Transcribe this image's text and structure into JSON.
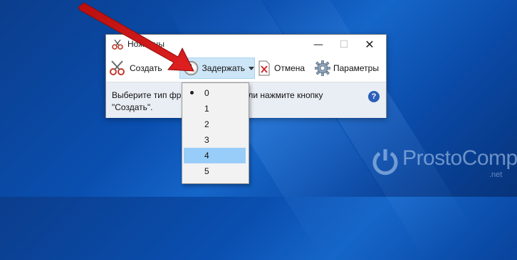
{
  "window": {
    "title": "Ножницы"
  },
  "toolbar": {
    "new_label": "Создать",
    "delay_label": "Задержать",
    "cancel_label": "Отмена",
    "options_label": "Параметры"
  },
  "info": {
    "line1": "Выберите тип фр",
    "line1_rest": "ли нажмите кнопку",
    "line2": "\"Создать\"."
  },
  "delay_menu": {
    "items": [
      "0",
      "1",
      "2",
      "3",
      "4",
      "5"
    ],
    "selected": "0",
    "highlighted": "4"
  },
  "watermark": {
    "text": "ProstoComp",
    "suffix": ".net"
  },
  "colors": {
    "arrow": "#d11a1a",
    "highlight": "#99cdf9",
    "delay_button_bg": "#cde6f7"
  }
}
